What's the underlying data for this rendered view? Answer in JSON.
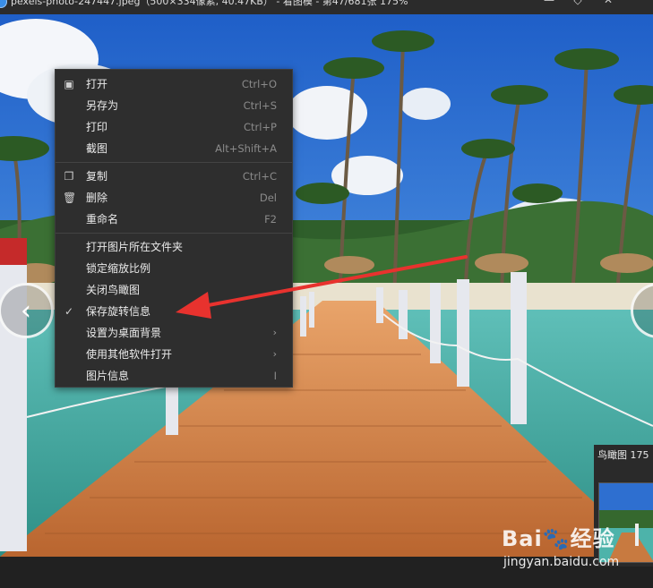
{
  "window": {
    "title": "pexels-photo-247447.jpeg（500×334像素, 40.47KB） - 看图模 - 第47/681张 175%",
    "buttons": [
      "—",
      "◇",
      "✕"
    ]
  },
  "context_menu": {
    "items": [
      {
        "label": "打开",
        "shortcut": "Ctrl+O",
        "icon": "image-icon",
        "glyph": "▣"
      },
      {
        "label": "另存为",
        "shortcut": "Ctrl+S"
      },
      {
        "label": "打印",
        "shortcut": "Ctrl+P"
      },
      {
        "label": "截图",
        "shortcut": "Alt+Shift+A"
      },
      {
        "separator": true
      },
      {
        "label": "复制",
        "shortcut": "Ctrl+C",
        "icon": "copy-icon",
        "glyph": "❐"
      },
      {
        "label": "删除",
        "shortcut": "Del",
        "icon": "trash-icon",
        "glyph": "🗑"
      },
      {
        "label": "重命名",
        "shortcut": "F2"
      },
      {
        "separator": true
      },
      {
        "label": "打开图片所在文件夹"
      },
      {
        "label": "锁定缩放比例"
      },
      {
        "label": "关闭鸟瞰图"
      },
      {
        "label": "保存旋转信息",
        "checked": true,
        "icon": "checkmark-icon",
        "glyph": "✓"
      },
      {
        "label": "设置为桌面背景",
        "submenu": true
      },
      {
        "label": "使用其他软件打开",
        "submenu": true
      },
      {
        "label": "图片信息",
        "shortcut": "I"
      }
    ]
  },
  "navigator": {
    "title": "鸟瞰图 175"
  },
  "viewer": {
    "prev_glyph": "‹",
    "next_glyph": "‹"
  },
  "watermark": {
    "logo": "Bai🐾经验",
    "url": "jingyan.baidu.com"
  },
  "colors": {
    "annotation_arrow": "#e8322e",
    "menu_bg": "#2e2e2e"
  }
}
